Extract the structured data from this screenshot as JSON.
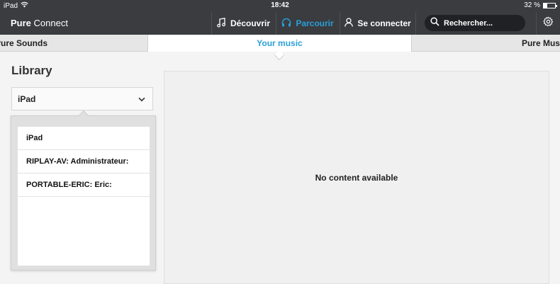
{
  "status_bar": {
    "device": "iPad",
    "time": "18:42",
    "battery_text": "32 %",
    "battery_level": 0.32
  },
  "app": {
    "brand_bold": "Pure",
    "brand_rest": "Connect"
  },
  "nav": {
    "discover": "Découvrir",
    "browse": "Parcourir",
    "login": "Se connecter",
    "active": "browse"
  },
  "search": {
    "placeholder": "Rechercher..."
  },
  "tabs": {
    "left": "Pure Sounds",
    "center": "Your music",
    "right": "Pure Music"
  },
  "library": {
    "title": "Library",
    "selected_device": "iPad",
    "options": [
      "iPad",
      "RIPLAY-AV: Administrateur:",
      "PORTABLE-ERIC: Eric:"
    ]
  },
  "content": {
    "empty_message": "No content available"
  },
  "colors": {
    "accent": "#2a9fd6",
    "topbar": "#3a3c40"
  }
}
